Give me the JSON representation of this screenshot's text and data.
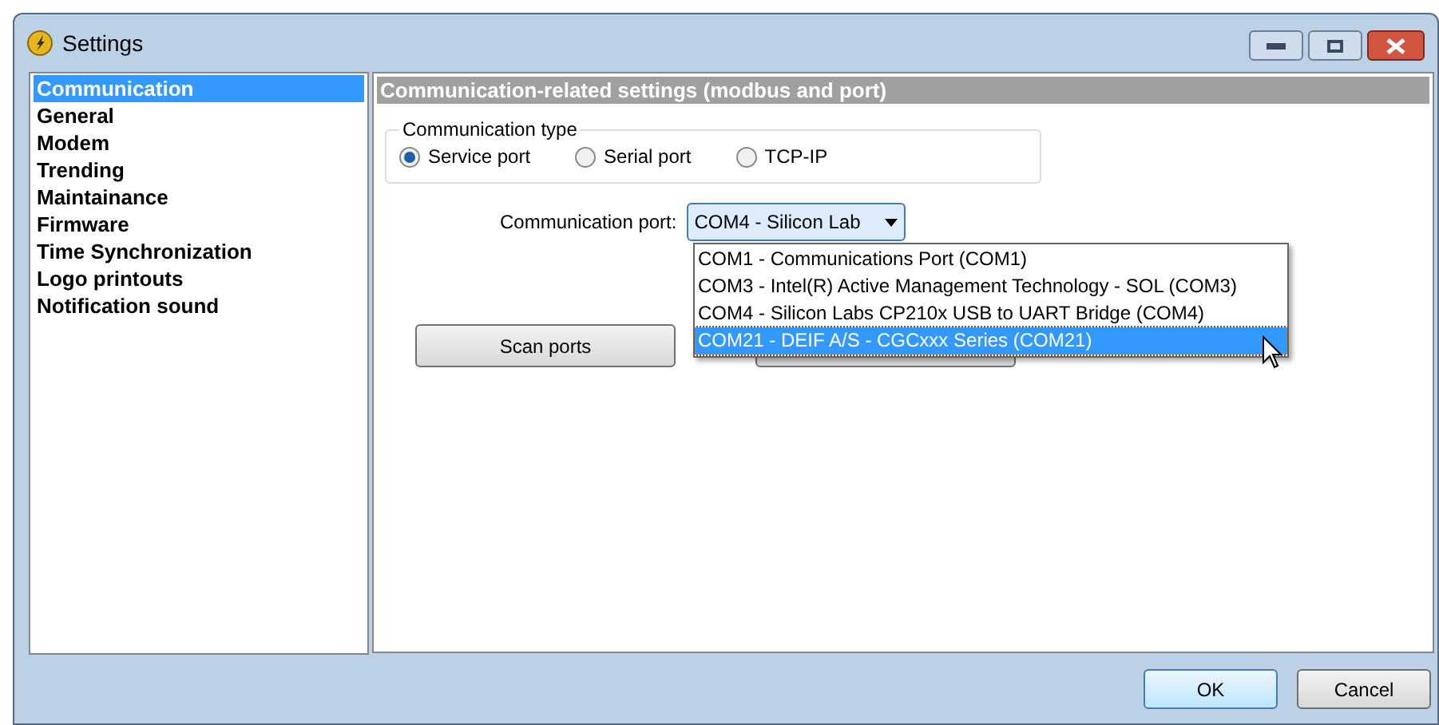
{
  "window": {
    "title": "Settings"
  },
  "sidebar": {
    "items": [
      {
        "label": "Communication",
        "selected": true
      },
      {
        "label": "General",
        "selected": false
      },
      {
        "label": "Modem",
        "selected": false
      },
      {
        "label": "Trending",
        "selected": false
      },
      {
        "label": "Maintainance",
        "selected": false
      },
      {
        "label": "Firmware",
        "selected": false
      },
      {
        "label": "Time Synchronization",
        "selected": false
      },
      {
        "label": "Logo printouts",
        "selected": false
      },
      {
        "label": "Notification sound",
        "selected": false
      }
    ]
  },
  "panel": {
    "header": "Communication-related settings (modbus and port)",
    "communication_type": {
      "legend": "Communication type",
      "options": [
        {
          "label": "Service port",
          "selected": true
        },
        {
          "label": "Serial port",
          "selected": false
        },
        {
          "label": "TCP-IP",
          "selected": false
        }
      ]
    },
    "port": {
      "label": "Communication port:",
      "value": "COM4 - Silicon Lab",
      "expanded": true,
      "options": [
        {
          "label": "COM1 - Communications Port (COM1)",
          "selected": false
        },
        {
          "label": "COM3 - Intel(R) Active Management Technology - SOL (COM3)",
          "selected": false
        },
        {
          "label": "COM4 - Silicon Labs CP210x USB to UART Bridge (COM4)",
          "selected": false
        },
        {
          "label": "COM21 - DEIF A/S - CGCxxx Series (COM21)",
          "selected": true
        }
      ]
    },
    "buttons": [
      "Scan ports"
    ]
  },
  "footer_buttons": [
    "OK",
    "Cancel"
  ]
}
